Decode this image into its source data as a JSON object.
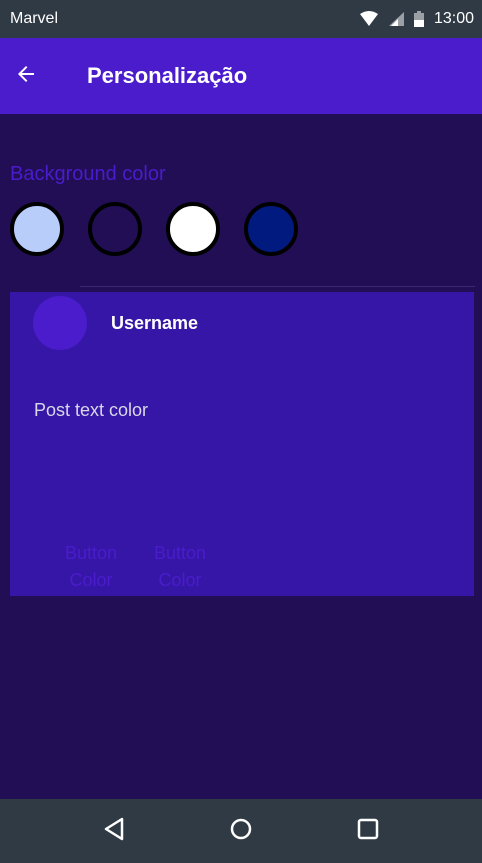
{
  "status_bar": {
    "carrier": "Marvel",
    "time": "13:00",
    "icons": [
      "wifi-icon",
      "signal-icon",
      "battery-icon"
    ]
  },
  "app_bar": {
    "title": "Personalização",
    "back_icon": "arrow-left-icon"
  },
  "background_section": {
    "label": "Background color",
    "swatches": [
      {
        "name": "light-blue",
        "color": "#b8cdfa"
      },
      {
        "name": "dark-purple",
        "color": "#210e55"
      },
      {
        "name": "white",
        "color": "#ffffff"
      },
      {
        "name": "navy",
        "color": "#001a80"
      }
    ]
  },
  "preview": {
    "username": "Username",
    "post_text": "Post text color",
    "buttons": [
      {
        "line1": "Button",
        "line2": "Color"
      },
      {
        "line1": "Button",
        "line2": "Color"
      }
    ]
  },
  "nav_bar": {
    "icons": [
      "back-triangle-icon",
      "home-circle-icon",
      "recents-square-icon"
    ]
  },
  "colors": {
    "status_bar": "#2f3a44",
    "app_bar": "#4a1ccc",
    "background": "#210e55",
    "card": "#3616a6",
    "accent": "#4a1ccc"
  }
}
